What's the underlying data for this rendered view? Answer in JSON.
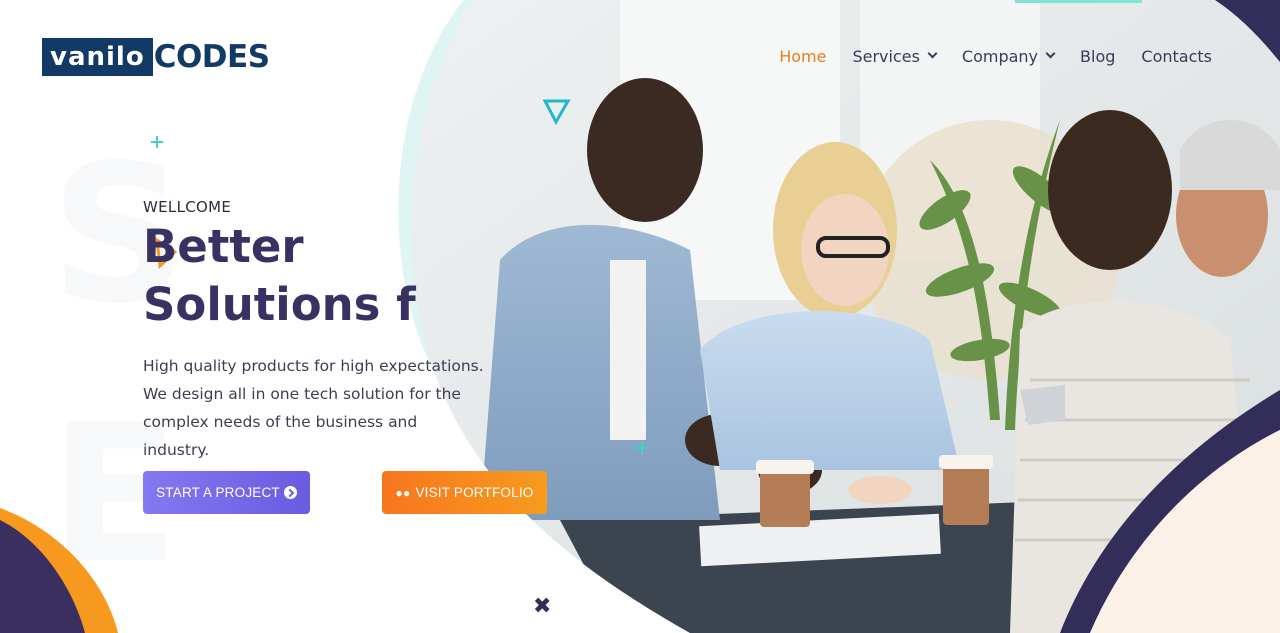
{
  "logo": {
    "part1": "vanilo",
    "part2": "CODES"
  },
  "nav": {
    "items": [
      {
        "label": "Home",
        "active": true,
        "dropdown": false
      },
      {
        "label": "Services",
        "active": false,
        "dropdown": true
      },
      {
        "label": "Company",
        "active": false,
        "dropdown": true
      },
      {
        "label": "Blog",
        "active": false,
        "dropdown": false
      },
      {
        "label": "Contacts",
        "active": false,
        "dropdown": false
      }
    ]
  },
  "hero": {
    "welcome": "WELLCOME",
    "title": "Better Solutions f",
    "description": "High quality products for high expectations. We design all in one tech solution for the complex needs of the business and industry.",
    "primary_button": "START A PROJECT",
    "secondary_button": "VISIT PORTFOLIO"
  },
  "icons": {
    "primary_button_icon": "circle-arrow-right-icon",
    "secondary_button_icon": "tripadvisor-icon",
    "close_icon": "close-icon"
  },
  "colors": {
    "accent": "#f07a1d",
    "brand_dark": "#123a66",
    "title": "#3a3163",
    "primary_button": "#7a6ae8",
    "secondary_button": "#f7871e"
  }
}
